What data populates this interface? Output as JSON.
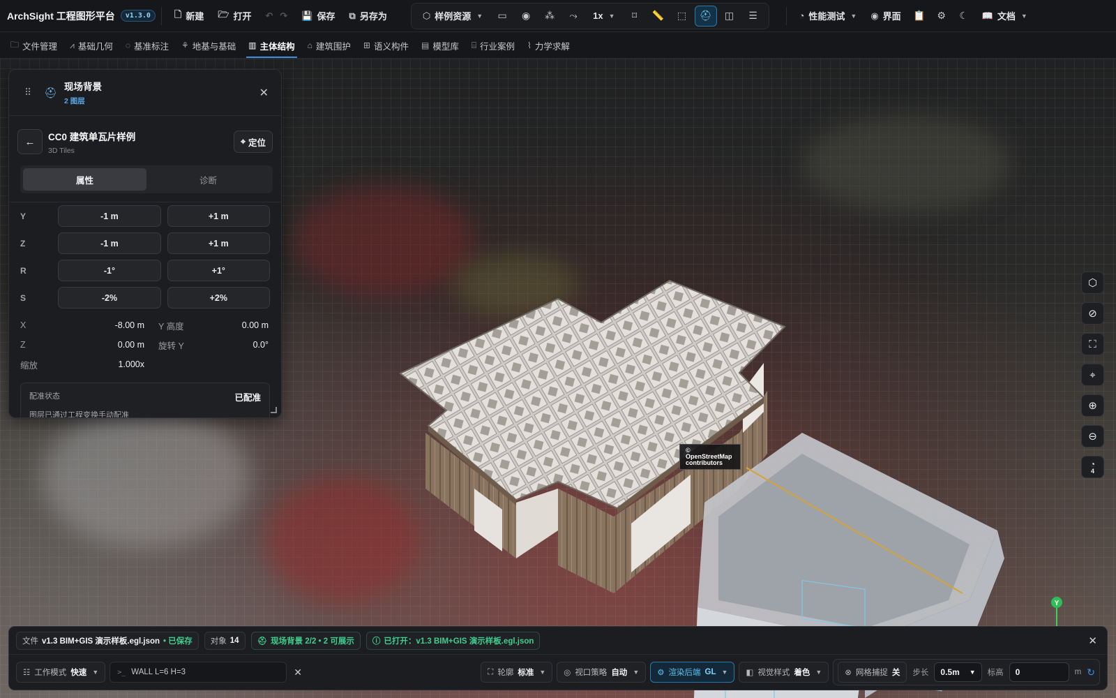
{
  "app": {
    "title": "ArchSight 工程图形平台",
    "version": "v1.3.0"
  },
  "toolbar": {
    "new_label": "新建",
    "open_label": "打开",
    "save_label": "保存",
    "save_as_label": "另存为",
    "sample_resources_label": "样例资源",
    "speed_label": "1x",
    "perf_test_label": "性能测试",
    "ui_label": "界面",
    "docs_label": "文档"
  },
  "menu": {
    "tabs": [
      {
        "label": "文件管理",
        "icon": "folder-icon"
      },
      {
        "label": "基础几何",
        "icon": "geometry-icon"
      },
      {
        "label": "基准标注",
        "icon": "target-icon"
      },
      {
        "label": "地基与基础",
        "icon": "foundation-icon"
      },
      {
        "label": "主体结构",
        "icon": "columns-icon",
        "active": true
      },
      {
        "label": "建筑围护",
        "icon": "house-icon"
      },
      {
        "label": "语义构件",
        "icon": "components-icon"
      },
      {
        "label": "模型库",
        "icon": "library-icon"
      },
      {
        "label": "行业案例",
        "icon": "briefcase-icon"
      },
      {
        "label": "力学求解",
        "icon": "chart-icon"
      }
    ]
  },
  "panel": {
    "title": "现场背景",
    "subtitle": "2 图层",
    "layer": {
      "name": "CC0 建筑单瓦片样例",
      "type": "3D Tiles",
      "locate_label": "定位"
    },
    "tabs": {
      "properties": "属性",
      "diagnostics": "诊断"
    },
    "nudge": [
      {
        "axis": "Y",
        "minus": "-1 m",
        "plus": "+1 m"
      },
      {
        "axis": "Z",
        "minus": "-1 m",
        "plus": "+1 m"
      },
      {
        "axis": "R",
        "minus": "-1°",
        "plus": "+1°"
      },
      {
        "axis": "S",
        "minus": "-2%",
        "plus": "+2%"
      }
    ],
    "transform": {
      "x_label": "X",
      "x_value": "-8.00 m",
      "y_label": "Y 高度",
      "y_value": "0.00 m",
      "z_label": "Z",
      "z_value": "0.00 m",
      "rot_label": "旋转 Y",
      "rot_value": "0.0°",
      "scale_label": "缩放",
      "scale_value": "1.000x"
    },
    "registration": {
      "label": "配准状态",
      "status": "已配准",
      "description": "图层已通过工程变换手动配准"
    }
  },
  "viewport": {
    "attribution": "© OpenStreetMap contributors",
    "zoom_badge": "4",
    "axis_y": "Y"
  },
  "status": {
    "file_label": "文件",
    "file_name": "v1.3 BIM+GIS 演示样板.egl.json",
    "file_saved": "• 已保存",
    "objects_label": "对象",
    "objects_count": "14",
    "scene_bg": "现场背景 2/2 • 2 可展示",
    "opened": "已打开：v1.3 BIM+GIS 演示样板.egl.json"
  },
  "controls": {
    "work_mode_label": "工作模式",
    "work_mode_value": "快速",
    "command_text": "WALL L=6 H=3",
    "outline_label": "轮廓",
    "outline_value": "标准",
    "viewport_policy_label": "视口策略",
    "viewport_policy_value": "自动",
    "render_backend_label": "渲染后端",
    "render_backend_value": "GL",
    "visual_style_label": "视觉样式",
    "visual_style_value": "着色",
    "grid_snap_label": "网格捕捉",
    "grid_snap_value": "关",
    "step_label": "步长",
    "step_value": "0.5m",
    "elevation_label": "标高",
    "elevation_value": "0",
    "elevation_unit": "m"
  },
  "colors": {
    "accent": "#3d8fe0",
    "success": "#3ecf8e",
    "panel_bg": "#1c1d21"
  }
}
